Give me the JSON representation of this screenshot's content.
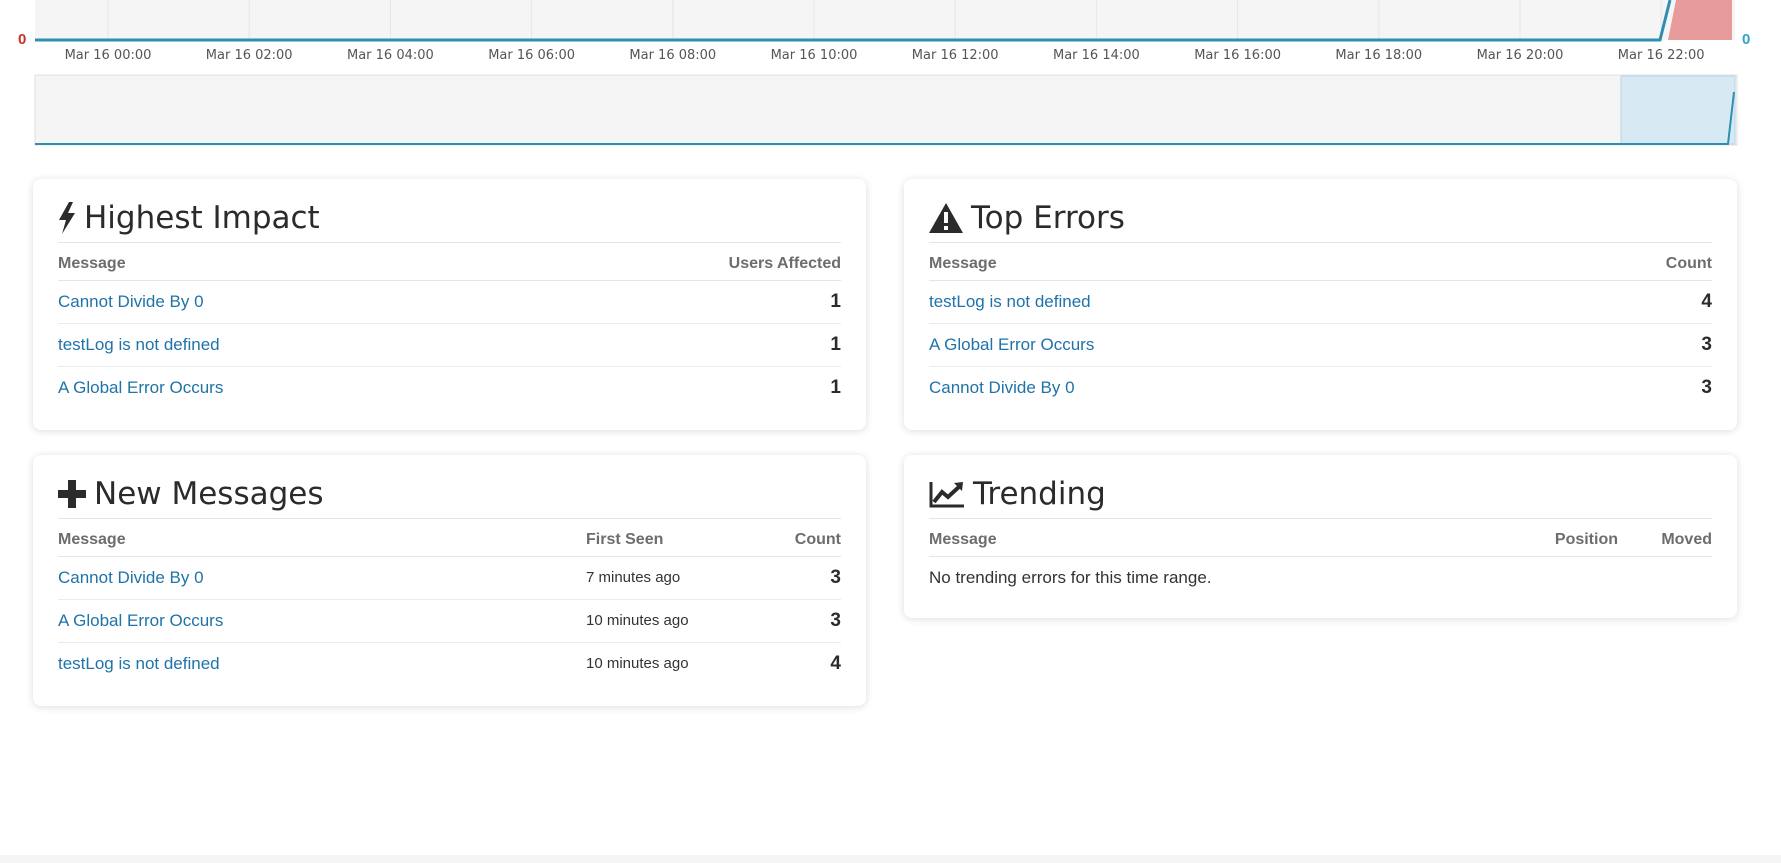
{
  "chart": {
    "left_axis_value": "0",
    "right_axis_value": "0",
    "x_tick_labels": [
      "Mar 16 00:00",
      "Mar 16 02:00",
      "Mar 16 04:00",
      "Mar 16 06:00",
      "Mar 16 08:00",
      "Mar 16 10:00",
      "Mar 16 12:00",
      "Mar 16 14:00",
      "Mar 16 16:00",
      "Mar 16 18:00",
      "Mar 16 20:00",
      "Mar 16 22:00"
    ],
    "colors": {
      "line": "#2f8fb3",
      "area": "#e79b9b",
      "axis_left": "#c9302c",
      "axis_right": "#2aa6c6",
      "selection": "#d7eaf4"
    }
  },
  "highest_impact": {
    "title": "Highest Impact",
    "icon": "bolt-icon",
    "columns": [
      "Message",
      "Users Affected"
    ],
    "rows": [
      {
        "message": "Cannot Divide By 0",
        "value": "1"
      },
      {
        "message": "testLog is not defined",
        "value": "1"
      },
      {
        "message": "A Global Error Occurs",
        "value": "1"
      }
    ]
  },
  "top_errors": {
    "title": "Top Errors",
    "icon": "warning-icon",
    "columns": [
      "Message",
      "Count"
    ],
    "rows": [
      {
        "message": "testLog is not defined",
        "value": "4"
      },
      {
        "message": "A Global Error Occurs",
        "value": "3"
      },
      {
        "message": "Cannot Divide By 0",
        "value": "3"
      }
    ]
  },
  "new_messages": {
    "title": "New Messages",
    "icon": "plus-icon",
    "columns": [
      "Message",
      "First Seen",
      "Count"
    ],
    "rows": [
      {
        "message": "Cannot Divide By 0",
        "first_seen": "7 minutes ago",
        "value": "3"
      },
      {
        "message": "A Global Error Occurs",
        "first_seen": "10 minutes ago",
        "value": "3"
      },
      {
        "message": "testLog is not defined",
        "first_seen": "10 minutes ago",
        "value": "4"
      }
    ]
  },
  "trending": {
    "title": "Trending",
    "icon": "trend-up-icon",
    "columns": [
      "Message",
      "Position",
      "Moved"
    ],
    "empty_text": "No trending errors for this time range."
  }
}
